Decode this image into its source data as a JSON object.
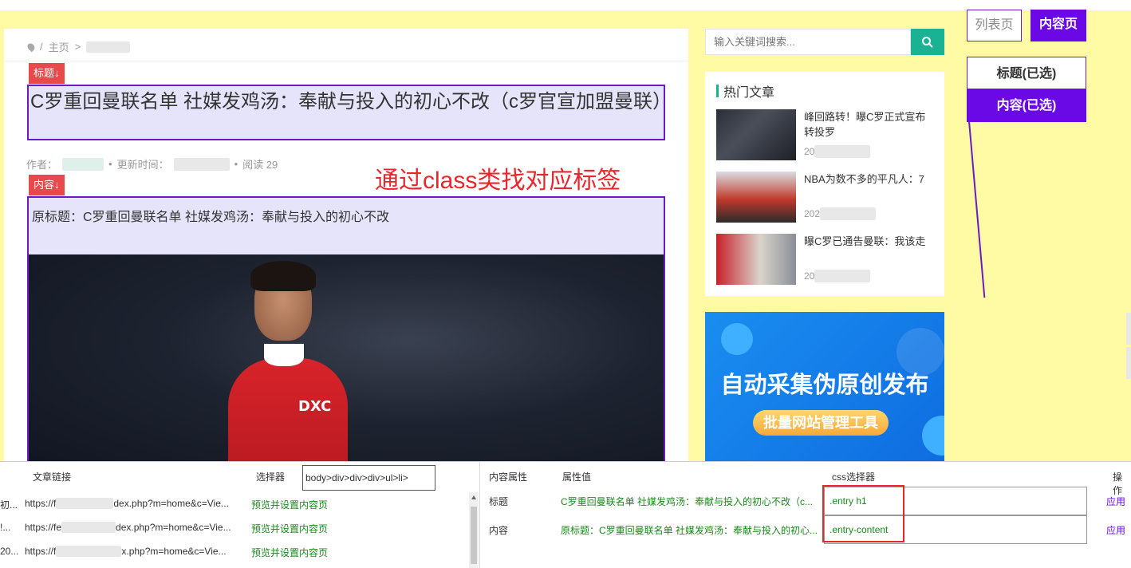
{
  "side_tabs": {
    "list_label": "列表页",
    "content_label": "内容页"
  },
  "selected": {
    "title_label": "标题(已选)",
    "content_label": "内容(已选)"
  },
  "article": {
    "breadcrumb_home": "主页",
    "breadcrumb_sep": ">",
    "title_tag": "标题↓",
    "title": "C罗重回曼联名单 社媒发鸡汤：奉献与投入的初心不改（c罗官宣加盟曼联）",
    "meta_author_label": "作者：",
    "meta_update_label": "更新时间：",
    "meta_reads": "阅读 29",
    "content_tag": "内容↓",
    "content_text": "原标题：C罗重回曼联名单 社媒发鸡汤：奉献与投入的初心不改",
    "photo_sponsor": "DXC",
    "overlay_text": "通过class类找对应标签"
  },
  "sidebar": {
    "search_placeholder": "输入关键词搜索...",
    "hot_title": "热门文章",
    "hot_items": [
      {
        "title": "峰回路转！曝C罗正式宣布转投罗",
        "date_prefix": "20"
      },
      {
        "title": "NBA为数不多的平凡人：7",
        "date_prefix": "202"
      },
      {
        "title": "曝C罗已通告曼联：我该走",
        "date_prefix": "20"
      }
    ],
    "banner_title": "自动采集伪原创发布",
    "banner_subtitle": "批量网站管理工具"
  },
  "bottom": {
    "col_link": "文章链接",
    "col_selector": "选择器",
    "selector_value": "body>div>div>div>ul>li>",
    "links": [
      {
        "pre": "初...",
        "url_prefix": "https://f",
        "url_suffix": "dex.php?m=home&c=Vie...",
        "action": "预览并设置内容页"
      },
      {
        "pre": "!...",
        "url_prefix": "https://fe",
        "url_suffix": "dex.php?m=home&c=Vie...",
        "action": "预览并设置内容页"
      },
      {
        "pre": "20...",
        "url_prefix": "https://f",
        "url_suffix": "x.php?m=home&c=Vie...",
        "action": "预览并设置内容页"
      }
    ],
    "col_attr": "内容属性",
    "col_value": "属性值",
    "col_css": "css选择器",
    "col_op": "操作",
    "attrs": [
      {
        "name": "标题",
        "value": "C罗重回曼联名单 社媒发鸡汤：奉献与投入的初心不改（c...",
        "css": ".entry h1",
        "apply": "应用"
      },
      {
        "name": "内容",
        "value": "原标题：C罗重回曼联名单 社媒发鸡汤：奉献与投入的初心...",
        "css": ".entry-content",
        "apply": "应用"
      }
    ]
  },
  "colors": {
    "accent": "#6a09e6",
    "tag_red": "#e8494b",
    "search_green": "#19b394",
    "page_yellow": "#fffaa3"
  }
}
